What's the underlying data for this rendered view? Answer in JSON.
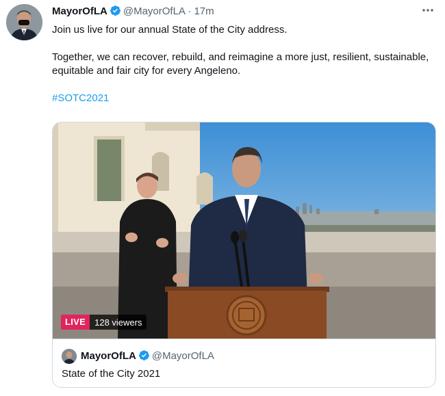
{
  "tweet": {
    "author_name": "MayorOfLA",
    "handle": "@MayorOfLA",
    "separator": "·",
    "time": "17m",
    "paragraph_1": "Join us live for our annual State of the City address.",
    "paragraph_2": "Together, we can recover, rebuild, and reimagine a more just, resilient, sustainable, equitable and fair city for every Angeleno.",
    "hashtag": "#SOTC2021"
  },
  "card": {
    "live_label": "LIVE",
    "viewers": "128 viewers",
    "author_name": "MayorOfLA",
    "handle": "@MayorOfLA",
    "title": "State of the City 2021"
  },
  "icons": {
    "verified": "verified-badge-icon",
    "more": "more-dots-icon"
  },
  "colors": {
    "link": "#1d9bf0",
    "verified": "#1d9bf0",
    "live": "#e0245e",
    "secondary_text": "#536471"
  }
}
